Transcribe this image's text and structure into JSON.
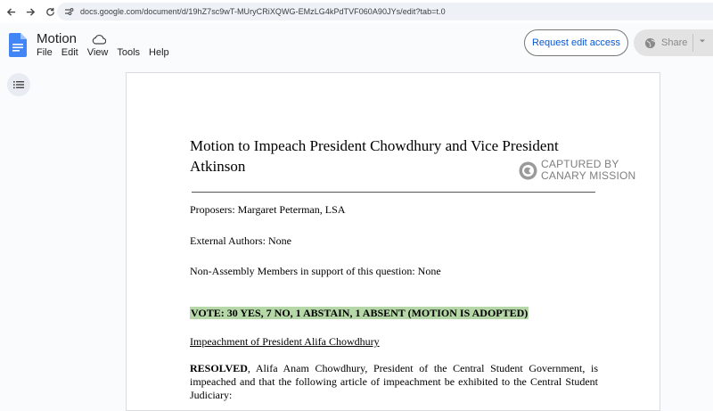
{
  "browser": {
    "url": "docs.google.com/document/d/19hZ7sc9wT-MUryCRiXQWG-EMzLG4kPdTVF060A90JYs/edit?tab=t.0",
    "icons": [
      "back-arrow-icon",
      "forward-arrow-icon",
      "reload-icon",
      "site-info-icon"
    ]
  },
  "docs": {
    "title": "Motion",
    "menu": [
      "File",
      "Edit",
      "View",
      "Tools",
      "Help"
    ],
    "request_edit_label": "Request edit access",
    "share_label": "Share"
  },
  "document": {
    "heading": "Motion to Impeach President Chowdhury and Vice President Atkinson",
    "proposers": "Proposers: Margaret Peterman, LSA",
    "external_authors": "External Authors: None",
    "non_assembly": "Non-Assembly Members in support of this question: None",
    "vote": "VOTE: 30 YES, 7 NO, 1 ABSTAIN, 1 ABSENT (MOTION IS ADOPTED)",
    "impeachment_heading": "Impeachment of President Alifa Chowdhury",
    "resolved_bold": "RESOLVED",
    "resolved_text": ", Alifa Anam Chowdhury, President of the Central Student Government, is impeached and that the following article of impeachment be exhibited to the Central Student Judiciary:"
  },
  "watermark": {
    "line1": "CAPTURED BY",
    "line2": "CANARY MISSION"
  },
  "colors": {
    "vote_highlight": "#b6d7a8",
    "request_button_text": "#0b57d0",
    "docs_blue": "#4285f4"
  }
}
